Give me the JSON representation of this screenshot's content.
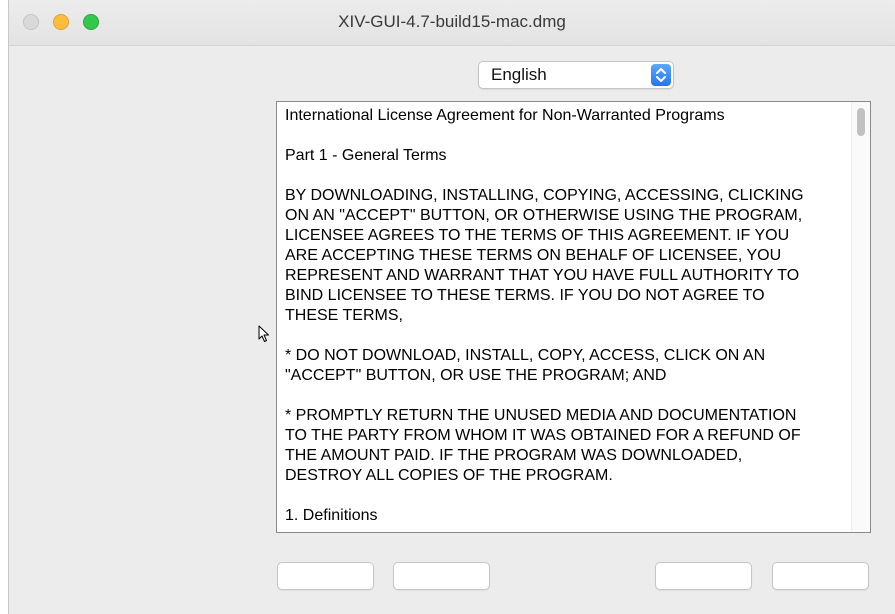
{
  "window": {
    "title": "XIV-GUI-4.7-build15-mac.dmg"
  },
  "language_select": {
    "selected": "English"
  },
  "license": {
    "paragraphs": [
      "International License Agreement for Non-Warranted Programs",
      "Part 1 - General Terms",
      "BY DOWNLOADING, INSTALLING, COPYING, ACCESSING, CLICKING\nON AN \"ACCEPT\" BUTTON, OR OTHERWISE USING THE PROGRAM,\nLICENSEE AGREES TO THE TERMS OF THIS AGREEMENT. IF YOU\nARE ACCEPTING THESE TERMS ON BEHALF OF LICENSEE, YOU\nREPRESENT AND WARRANT THAT YOU HAVE FULL AUTHORITY TO\nBIND LICENSEE TO THESE TERMS. IF YOU DO NOT AGREE TO\nTHESE TERMS,",
      "* DO NOT DOWNLOAD, INSTALL, COPY, ACCESS, CLICK ON AN\n\"ACCEPT\" BUTTON, OR USE THE PROGRAM; AND",
      "* PROMPTLY RETURN THE UNUSED MEDIA AND DOCUMENTATION\nTO THE PARTY FROM WHOM IT WAS OBTAINED FOR A REFUND OF\nTHE AMOUNT PAID. IF THE PROGRAM WAS DOWNLOADED,\nDESTROY ALL COPIES OF THE PROGRAM.",
      "1. Definitions"
    ]
  },
  "colors": {
    "window_bg": "#ececec",
    "close": "#d9d9d9",
    "minimize": "#fdbc40",
    "maximize": "#34c84a",
    "select_accent": "#1f78f4"
  }
}
